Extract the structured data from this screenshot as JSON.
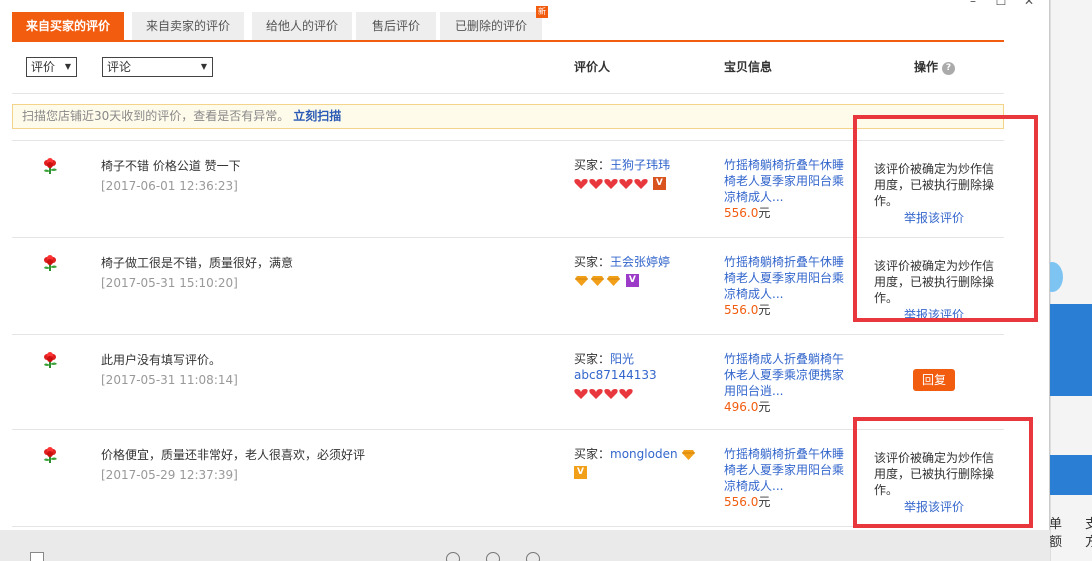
{
  "tabs": [
    {
      "label": "来自买家的评价",
      "active": true
    },
    {
      "label": "来自卖家的评价",
      "active": false
    },
    {
      "label": "给他人的评价",
      "active": false
    },
    {
      "label": "售后评价",
      "active": false
    },
    {
      "label": "已删除的评价",
      "active": false,
      "badge": "新"
    }
  ],
  "filters": {
    "rating_select": "评价",
    "comment_select": "评论"
  },
  "columns": {
    "rater": "评价人",
    "item_info": "宝贝信息",
    "action": "操作"
  },
  "notice": {
    "text": "扫描您店铺近30天收到的评价，查看是否有异常。",
    "link": "立刻扫描"
  },
  "rows": [
    {
      "comment": "椅子不错 价格公道 赞一下",
      "date": "[2017-06-01 12:36:23]",
      "buyer_label": "买家：",
      "buyer_name": "王狗子玮玮",
      "buyer_level": "heart x5",
      "item_title": "竹摇椅躺椅折叠午休睡椅老人夏季家用阳台乘凉椅成人...",
      "price": "556.0",
      "price_unit": "元",
      "status": "该评价被确定为炒作信用度，已被执行删除操作。",
      "report_link": "举报该评价"
    },
    {
      "comment": "椅子做工很是不错，质量很好，满意",
      "date": "[2017-05-31 15:10:20]",
      "buyer_label": "买家：",
      "buyer_name": "王会张婷婷",
      "buyer_level": "diamond x3",
      "item_title": "竹摇椅躺椅折叠午休睡椅老人夏季家用阳台乘凉椅成人...",
      "price": "556.0",
      "price_unit": "元",
      "status": "该评价被确定为炒作信用度，已被执行删除操作。",
      "report_link": "举报该评价"
    },
    {
      "comment": "此用户没有填写评价。",
      "date": "[2017-05-31 11:08:14]",
      "buyer_label": "买家：",
      "buyer_name": "阳光",
      "buyer_name2": "abc87144133",
      "buyer_level": "heart x4",
      "item_title": "竹摇椅成人折叠躺椅午休老人夏季乘凉便携家用阳台逍...",
      "price": "496.0",
      "price_unit": "元",
      "reply_button": "回复"
    },
    {
      "comment": "价格便宜，质量还非常好，老人很喜欢，必须好评",
      "date": "[2017-05-29 12:37:39]",
      "buyer_label": "买家：",
      "buyer_name": "mongloden",
      "buyer_level": "diamond x1",
      "item_title": "竹摇椅躺椅折叠午休睡椅老人夏季家用阳台乘凉椅成人...",
      "price": "556.0",
      "price_unit": "元",
      "status": "该评价被确定为炒作信用度，已被执行删除操作。",
      "report_link": "举报该评价"
    }
  ],
  "side_text": {
    "left_col": "单额",
    "right_col": "支方"
  },
  "colors": {
    "accent": "#f15c0f",
    "link": "#3366cc",
    "highlight_box": "#e8373d"
  }
}
